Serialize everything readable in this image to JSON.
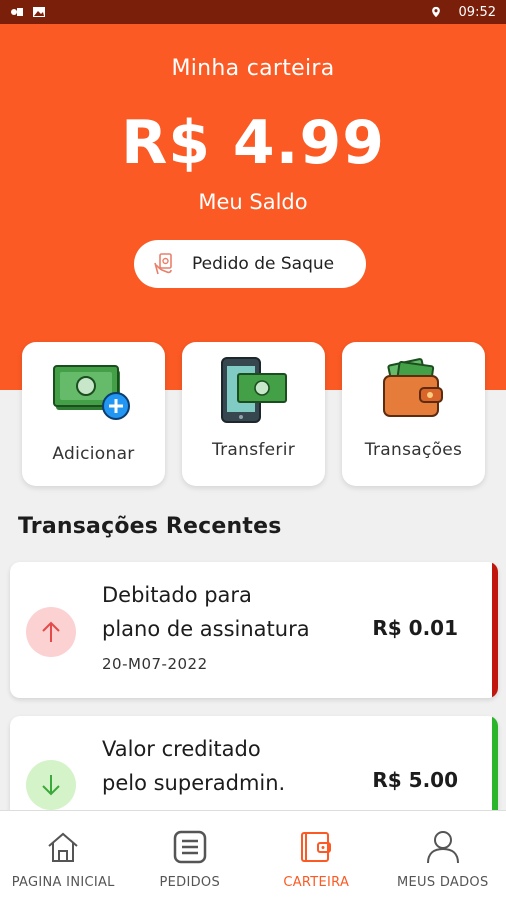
{
  "status_bar": {
    "time": "09:52"
  },
  "header": {
    "title": "Minha carteira",
    "balance": "R$ 4.99",
    "balance_label": "Meu Saldo",
    "withdraw_label": "Pedido de Saque"
  },
  "actions": [
    {
      "label": "Adicionar",
      "icon": "cash-add-icon"
    },
    {
      "label": "Transferir",
      "icon": "phone-transfer-icon"
    },
    {
      "label": "Transações",
      "icon": "wallet-icon"
    }
  ],
  "recent": {
    "title": "Transações Recentes",
    "items": [
      {
        "line1": "Debitado para",
        "line2": "plano de assinatura",
        "date": "20-M07-2022",
        "amount": "R$ 0.01",
        "direction": "debit",
        "stripe_color": "#c0160e",
        "icon_bg": "#fbd1d1",
        "icon_color": "#e44a4a"
      },
      {
        "line1": "Valor creditado",
        "line2": "pelo superadmin.",
        "date": "",
        "amount": "R$ 5.00",
        "direction": "credit",
        "stripe_color": "#2bb52b",
        "icon_bg": "#d4f3c9",
        "icon_color": "#3aa83a"
      }
    ]
  },
  "nav": [
    {
      "label": "PAGINA INICIAL",
      "icon": "home-icon",
      "active": false
    },
    {
      "label": "PEDIDOS",
      "icon": "orders-icon",
      "active": false
    },
    {
      "label": "CARTEIRA",
      "icon": "wallet-icon",
      "active": true
    },
    {
      "label": "MEUS DADOS",
      "icon": "user-icon",
      "active": false
    }
  ],
  "colors": {
    "accent": "#fb5a24",
    "status_bar": "#7a1f0a"
  }
}
